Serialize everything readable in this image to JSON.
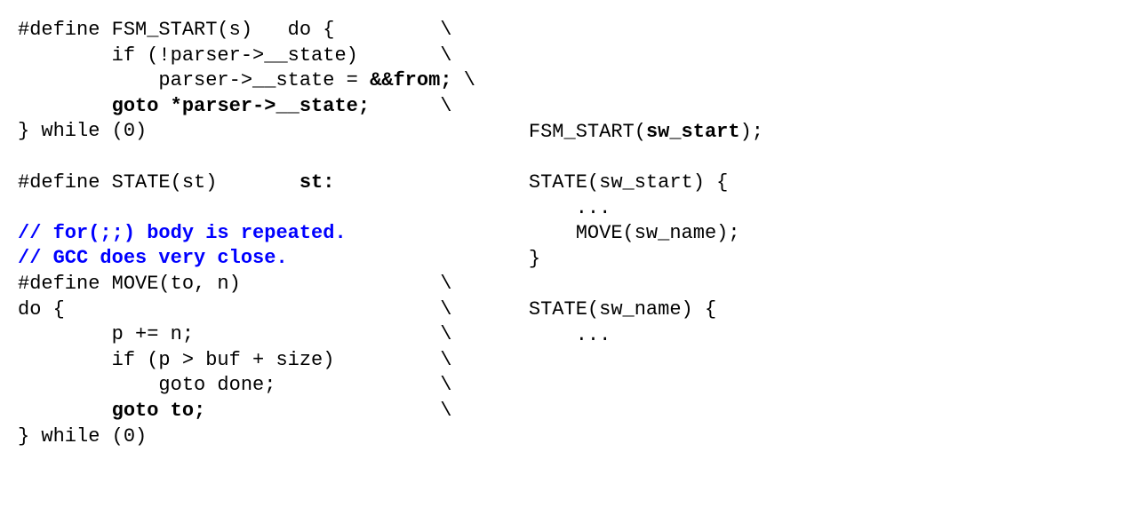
{
  "left": {
    "l1a": "#define FSM_START(s)   do {         \\",
    "l2a": "        if (!parser->__state)       \\",
    "l3a": "            parser->__state = ",
    "l3b": "&&from;",
    "l3c": " \\",
    "l4a": "        ",
    "l4b": "goto *parser->__state;",
    "l4c": "      \\",
    "l5a": "} while (0)",
    "blank1": " ",
    "l6a": "#define STATE(st)       ",
    "l6b": "st:",
    "blank2": " ",
    "c1": "// for(;;) body is repeated.",
    "c2": "// GCC does very close.",
    "l7a": "#define MOVE(to, n)                 \\",
    "l8a": "do {                                \\",
    "l9a": "        p += n;                     \\",
    "l10a": "        if (p > buf + size)         \\",
    "l11a": "            goto done;              \\",
    "l12a": "        ",
    "l12b": "goto to;",
    "l12c": "                    \\",
    "l13a": "} while (0)"
  },
  "right": {
    "r1a": "FSM_START(",
    "r1b": "sw_start",
    "r1c": ");",
    "blank1": " ",
    "r2": "STATE(sw_start) {",
    "r3": "    ...",
    "r4": "    MOVE(sw_name);",
    "r5": "}",
    "blank2": " ",
    "r6": "STATE(sw_name) {",
    "r7": "    ..."
  }
}
